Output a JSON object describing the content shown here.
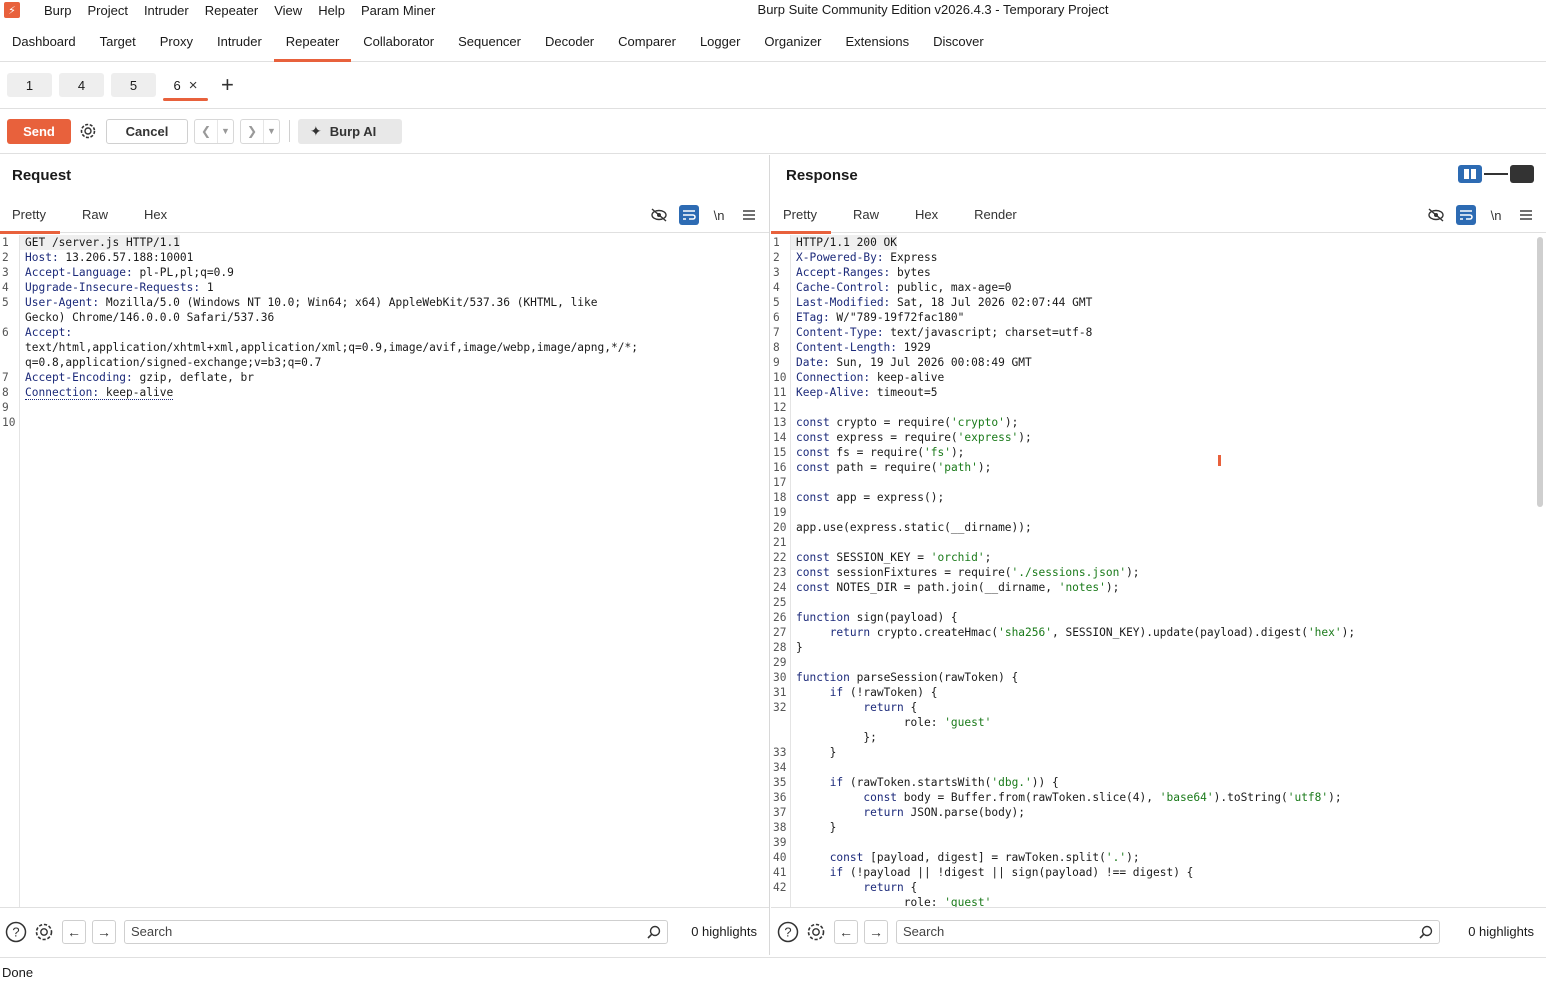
{
  "menu": {
    "items": [
      "Burp",
      "Project",
      "Intruder",
      "Repeater",
      "View",
      "Help",
      "Param Miner"
    ],
    "window_title": "Burp Suite Community Edition v2026.4.3 - Temporary Project"
  },
  "main_tabs": [
    "Dashboard",
    "Target",
    "Proxy",
    "Intruder",
    "Repeater",
    "Collaborator",
    "Sequencer",
    "Decoder",
    "Comparer",
    "Logger",
    "Organizer",
    "Extensions",
    "Discover"
  ],
  "active_main_tab": "Repeater",
  "repeater_tabs": [
    "1",
    "4",
    "5",
    "6"
  ],
  "active_repeater_tab": "6",
  "toolbar": {
    "send": "Send",
    "cancel": "Cancel",
    "burp_ai": "Burp AI"
  },
  "request": {
    "title": "Request",
    "view_tabs": [
      "Pretty",
      "Raw",
      "Hex"
    ],
    "newline_label": "\\n",
    "lines": [
      {
        "n": "1",
        "text": "GET /server.js HTTP/1.1"
      },
      {
        "n": "2",
        "text": "Host: 13.206.57.188:10001"
      },
      {
        "n": "3",
        "text": "Accept-Language: pl-PL,pl;q=0.9"
      },
      {
        "n": "4",
        "text": "Upgrade-Insecure-Requests: 1"
      },
      {
        "n": "5",
        "text": "User-Agent: Mozilla/5.0 (Windows NT 10.0; Win64; x64) AppleWebKit/537.36 (KHTML, like"
      },
      {
        "n": "",
        "text": "Gecko) Chrome/146.0.0.0 Safari/537.36"
      },
      {
        "n": "6",
        "text": "Accept:"
      },
      {
        "n": "",
        "text": "text/html,application/xhtml+xml,application/xml;q=0.9,image/avif,image/webp,image/apng,*/*;"
      },
      {
        "n": "",
        "text": "q=0.8,application/signed-exchange;v=b3;q=0.7"
      },
      {
        "n": "7",
        "text": "Accept-Encoding: gzip, deflate, br"
      },
      {
        "n": "8",
        "text": "Connection: keep-alive"
      },
      {
        "n": "9",
        "text": ""
      },
      {
        "n": "10",
        "text": ""
      }
    ],
    "search_placeholder": "Search",
    "highlights": "0 highlights"
  },
  "response": {
    "title": "Response",
    "view_tabs": [
      "Pretty",
      "Raw",
      "Hex",
      "Render"
    ],
    "newline_label": "\\n",
    "lines": [
      {
        "n": "1",
        "text": "HTTP/1.1 200 OK"
      },
      {
        "n": "2",
        "text": "X-Powered-By: Express"
      },
      {
        "n": "3",
        "text": "Accept-Ranges: bytes"
      },
      {
        "n": "4",
        "text": "Cache-Control: public, max-age=0"
      },
      {
        "n": "5",
        "text": "Last-Modified: Sat, 18 Jul 2026 02:07:44 GMT"
      },
      {
        "n": "6",
        "text": "ETag: W/\"789-19f72fac180\""
      },
      {
        "n": "7",
        "text": "Content-Type: text/javascript; charset=utf-8"
      },
      {
        "n": "8",
        "text": "Content-Length: 1929"
      },
      {
        "n": "9",
        "text": "Date: Sun, 19 Jul 2026 00:08:49 GMT"
      },
      {
        "n": "10",
        "text": "Connection: keep-alive"
      },
      {
        "n": "11",
        "text": "Keep-Alive: timeout=5"
      },
      {
        "n": "12",
        "text": ""
      },
      {
        "n": "13",
        "text": "const crypto = require('crypto');"
      },
      {
        "n": "14",
        "text": "const express = require('express');"
      },
      {
        "n": "15",
        "text": "const fs = require('fs');"
      },
      {
        "n": "16",
        "text": "const path = require('path');"
      },
      {
        "n": "17",
        "text": ""
      },
      {
        "n": "18",
        "text": "const app = express();"
      },
      {
        "n": "19",
        "text": ""
      },
      {
        "n": "20",
        "text": "app.use(express.static(__dirname));"
      },
      {
        "n": "21",
        "text": ""
      },
      {
        "n": "22",
        "text": "const SESSION_KEY = 'orchid';"
      },
      {
        "n": "23",
        "text": "const sessionFixtures = require('./sessions.json');"
      },
      {
        "n": "24",
        "text": "const NOTES_DIR = path.join(__dirname, 'notes');"
      },
      {
        "n": "25",
        "text": ""
      },
      {
        "n": "26",
        "text": "function sign(payload) {"
      },
      {
        "n": "27",
        "text": "     return crypto.createHmac('sha256', SESSION_KEY).update(payload).digest('hex');"
      },
      {
        "n": "28",
        "text": "}"
      },
      {
        "n": "29",
        "text": ""
      },
      {
        "n": "30",
        "text": "function parseSession(rawToken) {"
      },
      {
        "n": "31",
        "text": "     if (!rawToken) {"
      },
      {
        "n": "32",
        "text": "          return {"
      },
      {
        "n": "",
        "text": "                role: 'guest'"
      },
      {
        "n": "",
        "text": "          };"
      },
      {
        "n": "33",
        "text": "     }"
      },
      {
        "n": "34",
        "text": ""
      },
      {
        "n": "35",
        "text": "     if (rawToken.startsWith('dbg.')) {"
      },
      {
        "n": "36",
        "text": "          const body = Buffer.from(rawToken.slice(4), 'base64').toString('utf8');"
      },
      {
        "n": "37",
        "text": "          return JSON.parse(body);"
      },
      {
        "n": "38",
        "text": "     }"
      },
      {
        "n": "39",
        "text": ""
      },
      {
        "n": "40",
        "text": "     const [payload, digest] = rawToken.split('.');"
      },
      {
        "n": "41",
        "text": "     if (!payload || !digest || sign(payload) !== digest) {"
      },
      {
        "n": "42",
        "text": "          return {"
      },
      {
        "n": "",
        "text": "                role: 'guest'"
      }
    ],
    "search_placeholder": "Search",
    "highlights": "0 highlights"
  },
  "status": "Done",
  "colors": {
    "accent": "#e8613c",
    "toggle_blue": "#2d6bb3"
  }
}
